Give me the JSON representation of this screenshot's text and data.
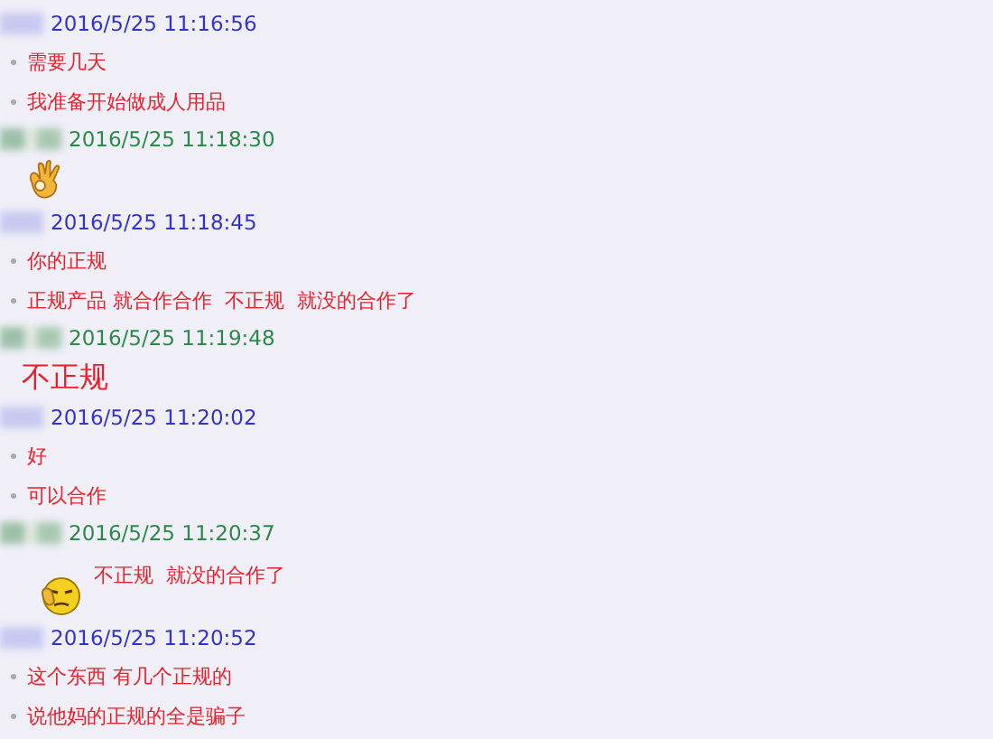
{
  "messages": [
    {
      "kind": "other",
      "time": "2016/5/25 11:16:56",
      "lines": [
        {
          "kind": "bullet",
          "text": "需要几天"
        },
        {
          "kind": "bullet",
          "text": "我准备开始做成人用品"
        }
      ]
    },
    {
      "kind": "self",
      "time": "2016/5/25 11:18:30",
      "lines": [
        {
          "kind": "hand_sticker"
        }
      ]
    },
    {
      "kind": "other",
      "time": "2016/5/25 11:18:45",
      "lines": [
        {
          "kind": "bullet",
          "text": "你的正规"
        },
        {
          "kind": "bullet",
          "text": "正规产品 就合作合作  不正规  就没的合作了"
        }
      ]
    },
    {
      "kind": "self",
      "time": "2016/5/25 11:19:48",
      "lines": [
        {
          "kind": "large",
          "text": "不正规"
        }
      ]
    },
    {
      "kind": "other",
      "time": "2016/5/25 11:20:02",
      "lines": [
        {
          "kind": "bullet",
          "text": "好"
        },
        {
          "kind": "bullet",
          "text": "可以合作"
        }
      ]
    },
    {
      "kind": "self",
      "time": "2016/5/25 11:20:37",
      "lines": [
        {
          "kind": "face_sticker",
          "text": "不正规  就没的合作了"
        }
      ]
    },
    {
      "kind": "other",
      "time": "2016/5/25 11:20:52",
      "lines": [
        {
          "kind": "bullet",
          "text": "这个东西 有几个正规的"
        },
        {
          "kind": "bullet",
          "text": "说他妈的正规的全是骗子"
        }
      ]
    }
  ]
}
